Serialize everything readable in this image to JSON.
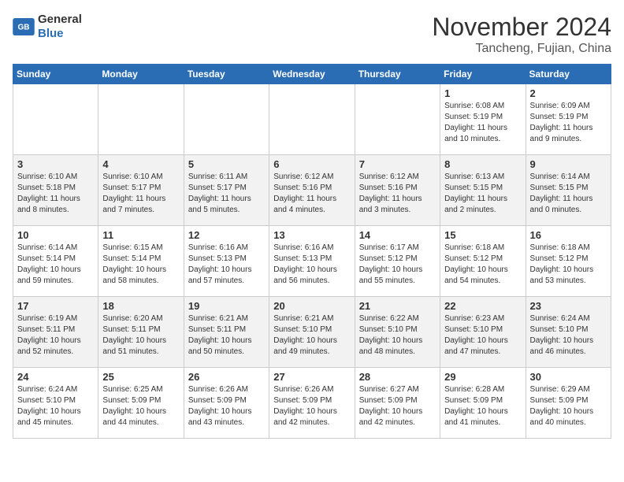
{
  "header": {
    "logo_general": "General",
    "logo_blue": "Blue",
    "month_title": "November 2024",
    "location": "Tancheng, Fujian, China"
  },
  "weekdays": [
    "Sunday",
    "Monday",
    "Tuesday",
    "Wednesday",
    "Thursday",
    "Friday",
    "Saturday"
  ],
  "weeks": [
    [
      {
        "day": "",
        "info": ""
      },
      {
        "day": "",
        "info": ""
      },
      {
        "day": "",
        "info": ""
      },
      {
        "day": "",
        "info": ""
      },
      {
        "day": "",
        "info": ""
      },
      {
        "day": "1",
        "info": "Sunrise: 6:08 AM\nSunset: 5:19 PM\nDaylight: 11 hours and 10 minutes."
      },
      {
        "day": "2",
        "info": "Sunrise: 6:09 AM\nSunset: 5:19 PM\nDaylight: 11 hours and 9 minutes."
      }
    ],
    [
      {
        "day": "3",
        "info": "Sunrise: 6:10 AM\nSunset: 5:18 PM\nDaylight: 11 hours and 8 minutes."
      },
      {
        "day": "4",
        "info": "Sunrise: 6:10 AM\nSunset: 5:17 PM\nDaylight: 11 hours and 7 minutes."
      },
      {
        "day": "5",
        "info": "Sunrise: 6:11 AM\nSunset: 5:17 PM\nDaylight: 11 hours and 5 minutes."
      },
      {
        "day": "6",
        "info": "Sunrise: 6:12 AM\nSunset: 5:16 PM\nDaylight: 11 hours and 4 minutes."
      },
      {
        "day": "7",
        "info": "Sunrise: 6:12 AM\nSunset: 5:16 PM\nDaylight: 11 hours and 3 minutes."
      },
      {
        "day": "8",
        "info": "Sunrise: 6:13 AM\nSunset: 5:15 PM\nDaylight: 11 hours and 2 minutes."
      },
      {
        "day": "9",
        "info": "Sunrise: 6:14 AM\nSunset: 5:15 PM\nDaylight: 11 hours and 0 minutes."
      }
    ],
    [
      {
        "day": "10",
        "info": "Sunrise: 6:14 AM\nSunset: 5:14 PM\nDaylight: 10 hours and 59 minutes."
      },
      {
        "day": "11",
        "info": "Sunrise: 6:15 AM\nSunset: 5:14 PM\nDaylight: 10 hours and 58 minutes."
      },
      {
        "day": "12",
        "info": "Sunrise: 6:16 AM\nSunset: 5:13 PM\nDaylight: 10 hours and 57 minutes."
      },
      {
        "day": "13",
        "info": "Sunrise: 6:16 AM\nSunset: 5:13 PM\nDaylight: 10 hours and 56 minutes."
      },
      {
        "day": "14",
        "info": "Sunrise: 6:17 AM\nSunset: 5:12 PM\nDaylight: 10 hours and 55 minutes."
      },
      {
        "day": "15",
        "info": "Sunrise: 6:18 AM\nSunset: 5:12 PM\nDaylight: 10 hours and 54 minutes."
      },
      {
        "day": "16",
        "info": "Sunrise: 6:18 AM\nSunset: 5:12 PM\nDaylight: 10 hours and 53 minutes."
      }
    ],
    [
      {
        "day": "17",
        "info": "Sunrise: 6:19 AM\nSunset: 5:11 PM\nDaylight: 10 hours and 52 minutes."
      },
      {
        "day": "18",
        "info": "Sunrise: 6:20 AM\nSunset: 5:11 PM\nDaylight: 10 hours and 51 minutes."
      },
      {
        "day": "19",
        "info": "Sunrise: 6:21 AM\nSunset: 5:11 PM\nDaylight: 10 hours and 50 minutes."
      },
      {
        "day": "20",
        "info": "Sunrise: 6:21 AM\nSunset: 5:10 PM\nDaylight: 10 hours and 49 minutes."
      },
      {
        "day": "21",
        "info": "Sunrise: 6:22 AM\nSunset: 5:10 PM\nDaylight: 10 hours and 48 minutes."
      },
      {
        "day": "22",
        "info": "Sunrise: 6:23 AM\nSunset: 5:10 PM\nDaylight: 10 hours and 47 minutes."
      },
      {
        "day": "23",
        "info": "Sunrise: 6:24 AM\nSunset: 5:10 PM\nDaylight: 10 hours and 46 minutes."
      }
    ],
    [
      {
        "day": "24",
        "info": "Sunrise: 6:24 AM\nSunset: 5:10 PM\nDaylight: 10 hours and 45 minutes."
      },
      {
        "day": "25",
        "info": "Sunrise: 6:25 AM\nSunset: 5:09 PM\nDaylight: 10 hours and 44 minutes."
      },
      {
        "day": "26",
        "info": "Sunrise: 6:26 AM\nSunset: 5:09 PM\nDaylight: 10 hours and 43 minutes."
      },
      {
        "day": "27",
        "info": "Sunrise: 6:26 AM\nSunset: 5:09 PM\nDaylight: 10 hours and 42 minutes."
      },
      {
        "day": "28",
        "info": "Sunrise: 6:27 AM\nSunset: 5:09 PM\nDaylight: 10 hours and 42 minutes."
      },
      {
        "day": "29",
        "info": "Sunrise: 6:28 AM\nSunset: 5:09 PM\nDaylight: 10 hours and 41 minutes."
      },
      {
        "day": "30",
        "info": "Sunrise: 6:29 AM\nSunset: 5:09 PM\nDaylight: 10 hours and 40 minutes."
      }
    ]
  ]
}
